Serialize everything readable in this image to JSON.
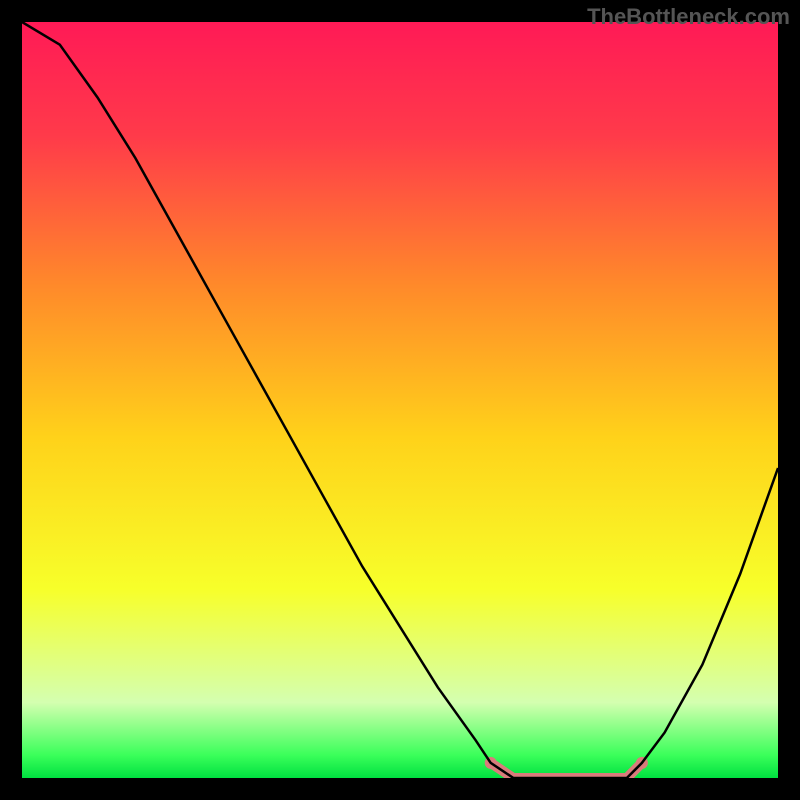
{
  "watermark": "TheBottleneck.com",
  "chart_data": {
    "type": "line",
    "title": "",
    "xlabel": "",
    "ylabel": "",
    "x": [
      0.0,
      0.05,
      0.1,
      0.15,
      0.2,
      0.25,
      0.3,
      0.35,
      0.4,
      0.45,
      0.5,
      0.55,
      0.6,
      0.62,
      0.65,
      0.7,
      0.75,
      0.8,
      0.82,
      0.85,
      0.9,
      0.95,
      1.0
    ],
    "values": [
      1.0,
      0.97,
      0.9,
      0.82,
      0.73,
      0.64,
      0.55,
      0.46,
      0.37,
      0.28,
      0.2,
      0.12,
      0.05,
      0.02,
      0.0,
      0.0,
      0.0,
      0.0,
      0.02,
      0.06,
      0.15,
      0.27,
      0.41
    ],
    "xlim": [
      0,
      1
    ],
    "ylim": [
      0,
      1
    ],
    "highlight_range": [
      0.62,
      0.82
    ],
    "gradient_stops": [
      {
        "pos": 0.0,
        "color": "#ff1a56"
      },
      {
        "pos": 0.15,
        "color": "#ff3a4a"
      },
      {
        "pos": 0.35,
        "color": "#ff8a2a"
      },
      {
        "pos": 0.55,
        "color": "#ffd21a"
      },
      {
        "pos": 0.75,
        "color": "#f7ff2a"
      },
      {
        "pos": 0.9,
        "color": "#d4ffb0"
      },
      {
        "pos": 0.97,
        "color": "#3aff5a"
      },
      {
        "pos": 1.0,
        "color": "#00e040"
      }
    ]
  }
}
